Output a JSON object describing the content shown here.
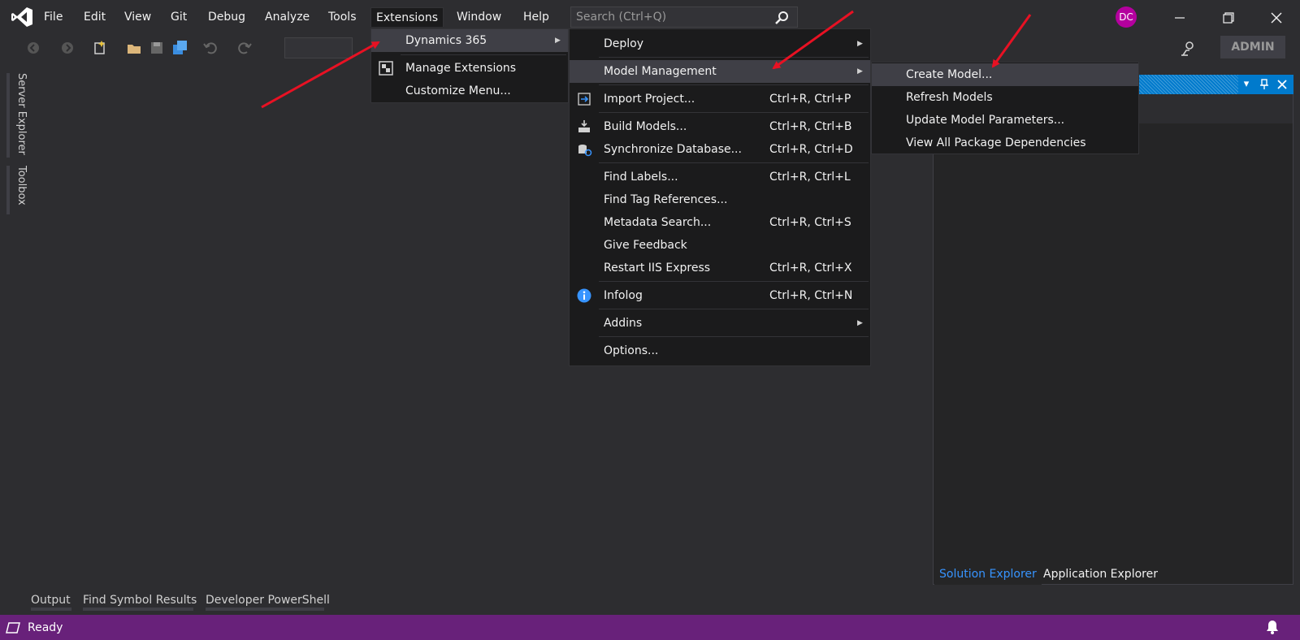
{
  "menubar": {
    "items": [
      "File",
      "Edit",
      "View",
      "Git",
      "Debug",
      "Analyze",
      "Tools",
      "Extensions",
      "Window",
      "Help"
    ],
    "search_placeholder": "Search (Ctrl+Q)"
  },
  "account": {
    "avatar_initials": "DC",
    "admin_label": "ADMIN"
  },
  "side_tabs": [
    "Server Explorer",
    "Toolbox"
  ],
  "extensions_menu": {
    "items": [
      {
        "label": "Dynamics 365",
        "submenu": true,
        "icon": ""
      },
      {
        "label": "Manage Extensions",
        "icon": "extensions-icon"
      },
      {
        "label": "Customize Menu...",
        "icon": ""
      }
    ]
  },
  "dynamics_menu": {
    "items": [
      {
        "label": "Deploy",
        "shortcut": "",
        "submenu": true,
        "icon": ""
      },
      {
        "label": "Model Management",
        "shortcut": "",
        "submenu": true,
        "icon": ""
      },
      {
        "label": "Import Project...",
        "shortcut": "Ctrl+R, Ctrl+P",
        "icon": "import-project-icon"
      },
      {
        "label": "Build Models...",
        "shortcut": "Ctrl+R, Ctrl+B",
        "icon": "build-models-icon"
      },
      {
        "label": "Synchronize Database...",
        "shortcut": "Ctrl+R, Ctrl+D",
        "icon": "database-sync-icon"
      },
      {
        "label": "Find Labels...",
        "shortcut": "Ctrl+R, Ctrl+L",
        "icon": ""
      },
      {
        "label": "Find Tag References...",
        "shortcut": "",
        "icon": ""
      },
      {
        "label": "Metadata Search...",
        "shortcut": "Ctrl+R, Ctrl+S",
        "icon": ""
      },
      {
        "label": "Give Feedback",
        "shortcut": "",
        "icon": ""
      },
      {
        "label": "Restart IIS Express",
        "shortcut": "Ctrl+R, Ctrl+X",
        "icon": ""
      },
      {
        "label": "Infolog",
        "shortcut": "Ctrl+R, Ctrl+N",
        "icon": "info-icon"
      },
      {
        "label": "Addins",
        "shortcut": "",
        "submenu": true,
        "icon": ""
      },
      {
        "label": "Options...",
        "shortcut": "",
        "icon": ""
      }
    ]
  },
  "model_management_menu": {
    "items": [
      {
        "label": "Create Model..."
      },
      {
        "label": "Refresh Models"
      },
      {
        "label": "Update Model Parameters..."
      },
      {
        "label": "View All Package Dependencies"
      }
    ]
  },
  "right_panel": {
    "tabs": [
      "Solution Explorer",
      "Application Explorer"
    ]
  },
  "bottom_tool_tabs": [
    "Output",
    "Find Symbol Results",
    "Developer PowerShell"
  ],
  "status": {
    "text": "Ready"
  },
  "colors": {
    "accent": "#007acc",
    "status_bar": "#68217a",
    "avatar": "#b4009e",
    "annotation_arrow": "#e81123"
  }
}
